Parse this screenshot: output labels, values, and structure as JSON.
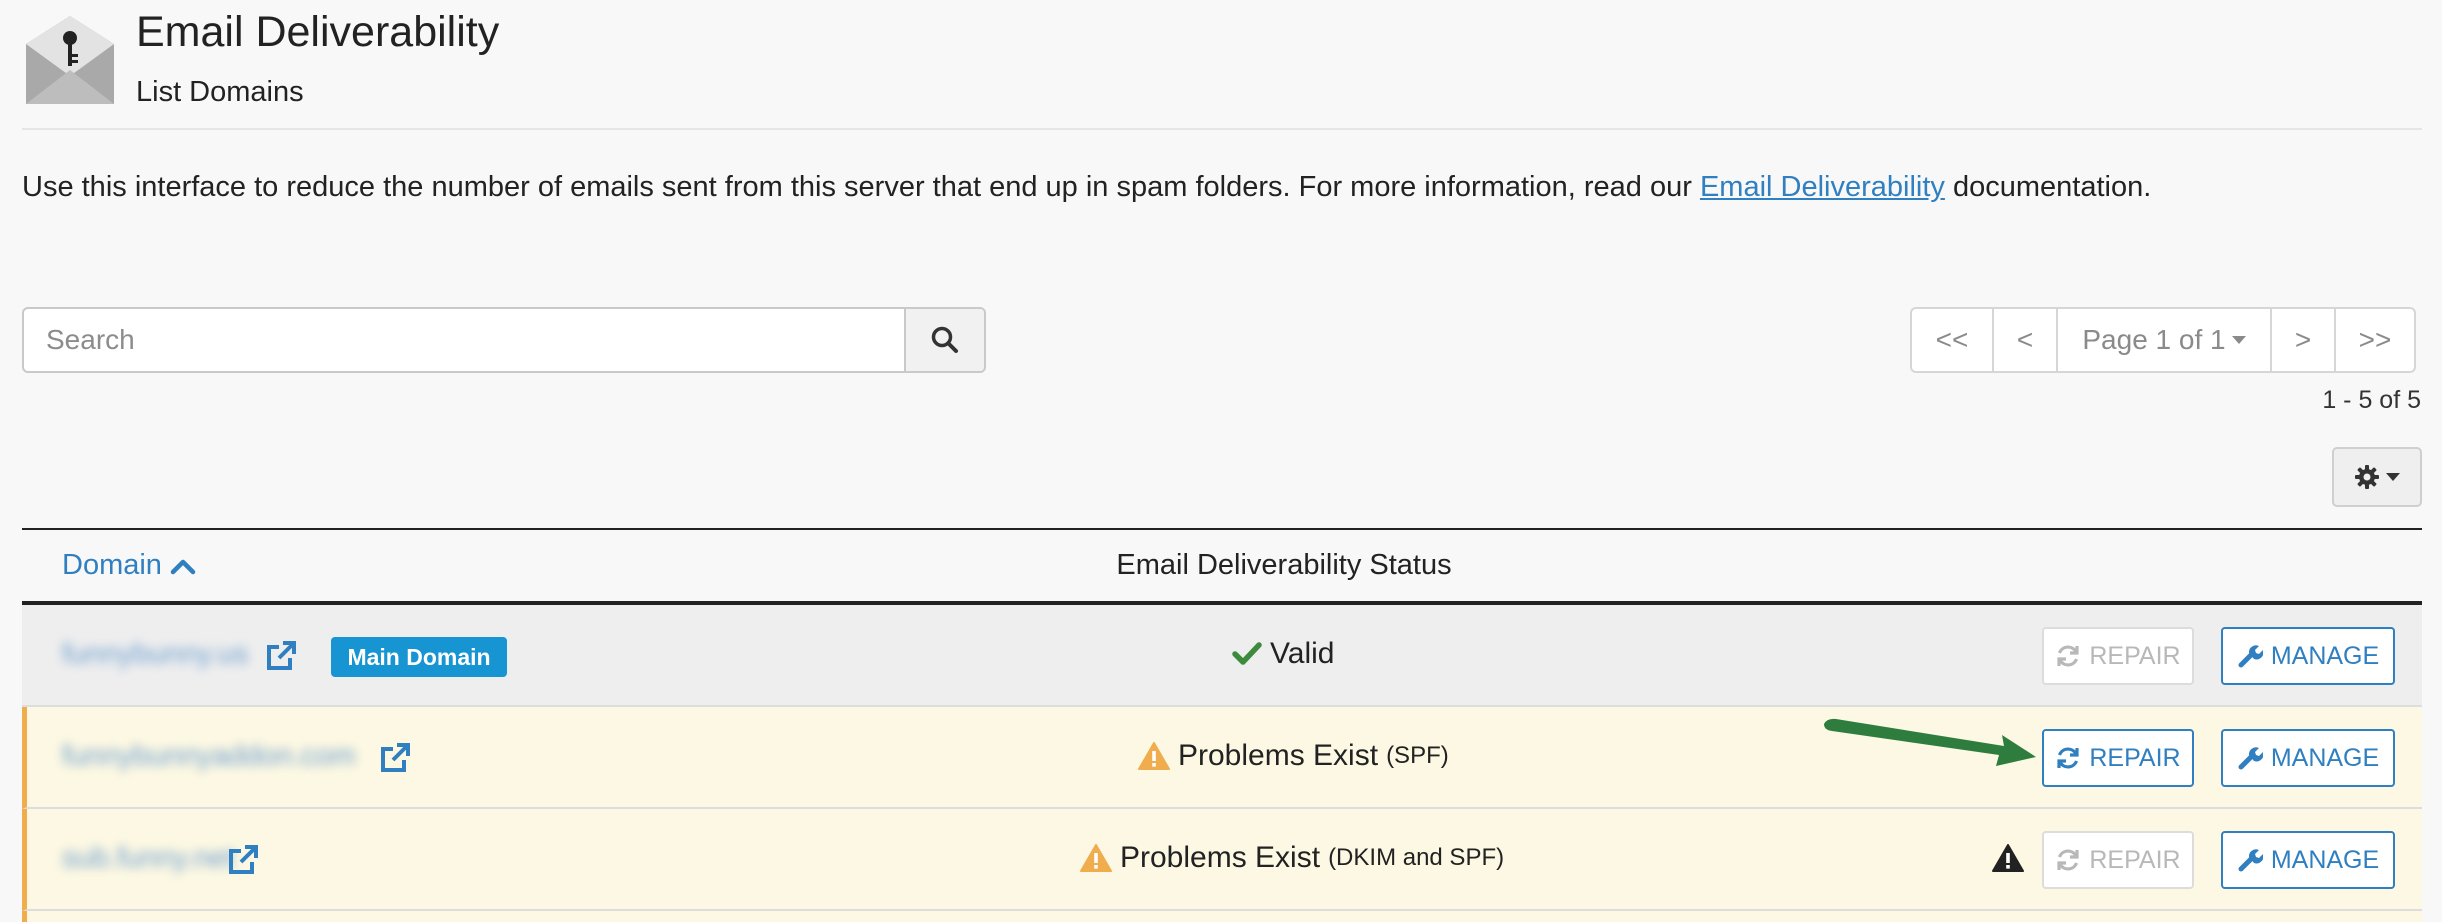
{
  "header": {
    "title": "Email Deliverability",
    "subtitle": "List Domains",
    "icon": "envelope-key-icon"
  },
  "intro": {
    "before_link": "Use this interface to reduce the number of emails sent from this server that end up in spam folders. For more information, read our ",
    "link_text": "Email Deliverability",
    "after_link": " documentation."
  },
  "search": {
    "placeholder": "Search",
    "value": ""
  },
  "pagination": {
    "first": "<<",
    "prev": "<",
    "page_label": "Page 1 of 1",
    "next": ">",
    "last": ">>",
    "count": "1 - 5 of 5"
  },
  "table": {
    "col_domain": "Domain",
    "col_status": "Email Deliverability Status",
    "rows": [
      {
        "domain": "funnybunny.us",
        "badge": "Main Domain",
        "status_icon": "check-icon",
        "status": "Valid",
        "status_detail": "",
        "repair_label": "REPAIR",
        "repair_enabled": false,
        "manage_label": "MANAGE"
      },
      {
        "domain": "funnybunnyaddon.com",
        "badge": "",
        "status_icon": "warning-icon",
        "status": "Problems Exist",
        "status_detail": "(SPF)",
        "repair_label": "REPAIR",
        "repair_enabled": true,
        "manage_label": "MANAGE"
      },
      {
        "domain": "sub.funny.net",
        "badge": "",
        "status_icon": "warning-icon",
        "status": "Problems Exist",
        "status_detail": "(DKIM and SPF)",
        "repair_label": "REPAIR",
        "repair_enabled": false,
        "manage_label": "MANAGE"
      }
    ]
  },
  "colors": {
    "link": "#2f7fc1",
    "badge": "#1795d3",
    "warning": "#f0ad4e",
    "valid": "#3c8a3c",
    "row_warning_bg": "#fcf8e3",
    "annotation_arrow": "#2e7d3e"
  }
}
